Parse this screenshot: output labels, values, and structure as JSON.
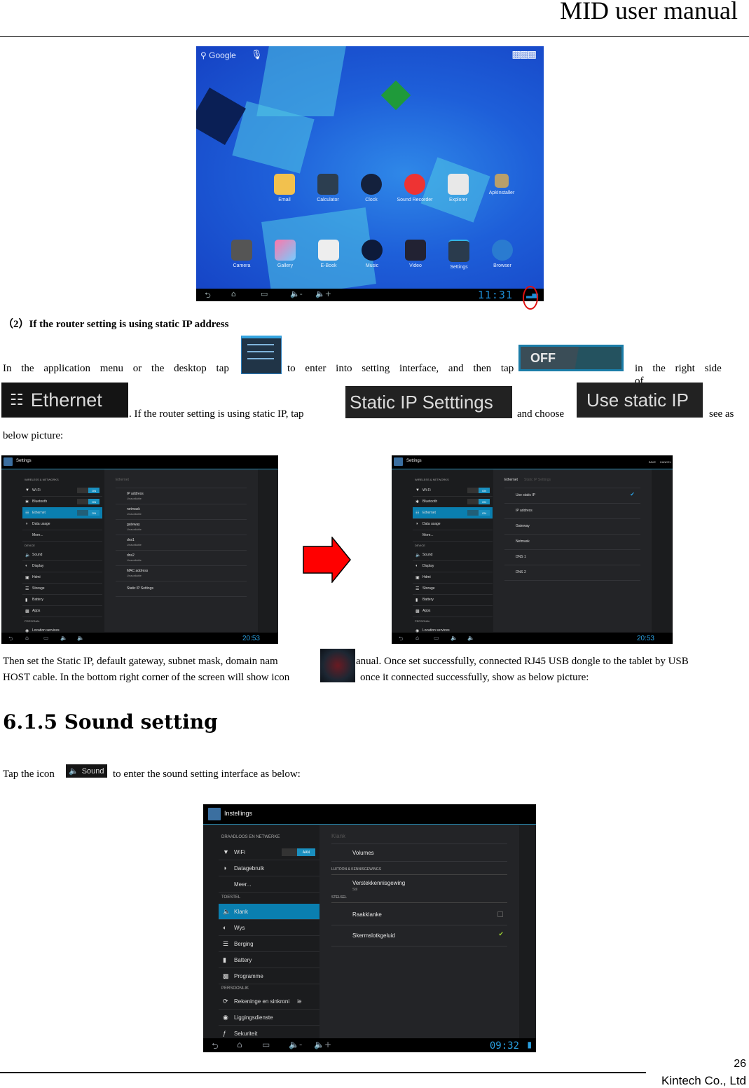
{
  "header": {
    "title": "MID user manual"
  },
  "footer": {
    "page_number": "26",
    "company": "Kintech Co., Ltd"
  },
  "home_screenshot": {
    "search_label": "Google",
    "app_row_1": [
      "Email",
      "Calculator",
      "Clock",
      "Sound Recorder",
      "Explorer",
      "ApkInstaller"
    ],
    "app_row_2": [
      "Camera",
      "Gallery",
      "E-Book",
      "Music",
      "Video",
      "Settings",
      "Browser"
    ],
    "clock": "11:31",
    "highlight": "status-icon circled in red"
  },
  "section_static_ip": {
    "heading": "（2）If the router setting is using static IP address",
    "para1_part1": "In the application menu or the desktop tap",
    "para1_part2": "to enter into setting interface, and then tap",
    "off_chip": "OFF",
    "para1_part3": "in the right side of",
    "ethernet_chip": "Ethernet",
    "para1_part4": ". If the router setting is using static IP, tap",
    "static_ip_settings_chip": "Static IP Setttings",
    "para1_part5": "and choose",
    "use_static_ip_chip": "Use static IP",
    "para1_part6": "see as",
    "para1_part7": "below picture:"
  },
  "ethernet_shot_before": {
    "title": "Settings",
    "sections": {
      "wireless": "WIRELESS & NETWORKS",
      "device": "DEVICE",
      "personal": "PERSONAL"
    },
    "left_items": [
      {
        "label": "Wi-Fi",
        "icon": "wifi-icon",
        "toggle": "ON"
      },
      {
        "label": "Bluetooth",
        "icon": "bluetooth-icon",
        "toggle": "ON"
      },
      {
        "label": "Ethernet",
        "icon": "ethernet-icon",
        "toggle": "ON",
        "selected": true
      },
      {
        "label": "Data usage",
        "icon": "data-usage-icon"
      },
      {
        "label": "More...",
        "icon": ""
      },
      {
        "label": "Sound",
        "icon": "sound-icon"
      },
      {
        "label": "Display",
        "icon": "display-icon"
      },
      {
        "label": "Hdmi",
        "icon": "hdmi-icon"
      },
      {
        "label": "Storage",
        "icon": "storage-icon"
      },
      {
        "label": "Battery",
        "icon": "battery-icon"
      },
      {
        "label": "Apps",
        "icon": "apps-icon"
      },
      {
        "label": "Location services",
        "icon": "location-icon"
      }
    ],
    "pane_title": "Ethernet",
    "rows": [
      {
        "label": "IP address",
        "value": "Unavailable"
      },
      {
        "label": "netmask",
        "value": "Unavailable"
      },
      {
        "label": "gateway",
        "value": "Unavailable"
      },
      {
        "label": "dns1",
        "value": "Unavailable"
      },
      {
        "label": "dns2",
        "value": "Unavailable"
      },
      {
        "label": "MAC address",
        "value": "Unavailable"
      },
      {
        "label": "Static IP Settings",
        "value": ""
      }
    ],
    "clock": "20:53"
  },
  "ethernet_shot_after": {
    "title": "Settings",
    "save_label": "SAVE",
    "cancel_label": "CANCEL",
    "breadcrumb_parent": "Ethernet",
    "breadcrumb_current": "Static IP Settings",
    "rows": [
      {
        "label": "Use static IP",
        "checked": true
      },
      {
        "label": "IP address"
      },
      {
        "label": "Gateway"
      },
      {
        "label": "Netmask"
      },
      {
        "label": "DNS 1"
      },
      {
        "label": "DNS 2"
      }
    ],
    "clock": "20:53"
  },
  "para2": {
    "line1": "Then set the Static IP, default gateway, subnet mask, domain nam",
    "line1b": "anual. Once set successfully, connected RJ45 USB dongle to the tablet by USB",
    "line2a": "HOST cable. In the bottom right corner of the screen will show icon",
    "line2b": "once it connected successfully, show as below picture:"
  },
  "section_sound": {
    "heading": "6.1.5 Sound setting",
    "para_part1": "Tap the icon",
    "sound_chip": "Sound",
    "para_part2": "to enter the sound setting interface as below:"
  },
  "klank_shot": {
    "title": "Instellings",
    "sections": {
      "wireless": "DRAADLOOS EN NETWERKE",
      "device": "TOESTEL",
      "personal": "PERSOONLIK"
    },
    "left_items": [
      {
        "label": "WiFi",
        "icon": "wifi-icon",
        "toggle": "AAN"
      },
      {
        "label": "Datagebruik",
        "icon": "data-usage-icon"
      },
      {
        "label": "Meer...",
        "icon": ""
      },
      {
        "label": "Klank",
        "icon": "sound-icon",
        "selected": true
      },
      {
        "label": "Wys",
        "icon": "display-icon"
      },
      {
        "label": "Berging",
        "icon": "storage-icon"
      },
      {
        "label": "Battery",
        "icon": "battery-icon"
      },
      {
        "label": "Programme",
        "icon": "apps-icon"
      },
      {
        "label": "Rekeninge en sinkroni     ie",
        "icon": "sync-icon"
      },
      {
        "label": "Liggingsdienste",
        "icon": "location-icon"
      },
      {
        "label": "Sekuriteit",
        "icon": "security-icon"
      }
    ],
    "pane_title": "Klank",
    "volumes": "Volumes",
    "sect_ringtone": "LUITOON & KENNISGEWINGS",
    "notif_label": "Verstekkennisgewing",
    "notif_value": "Stil",
    "sect_system": "STELSEL",
    "touch_sounds": {
      "label": "Raakklanke",
      "checked": false
    },
    "lock_sound": {
      "label": "Skermslotkgeluid",
      "checked": true
    },
    "clock": "09:32"
  },
  "colors": {
    "accent_blue": "#0a7fb0",
    "arrow_red": "#ff0000",
    "clock_blue": "#2aa0e0"
  }
}
